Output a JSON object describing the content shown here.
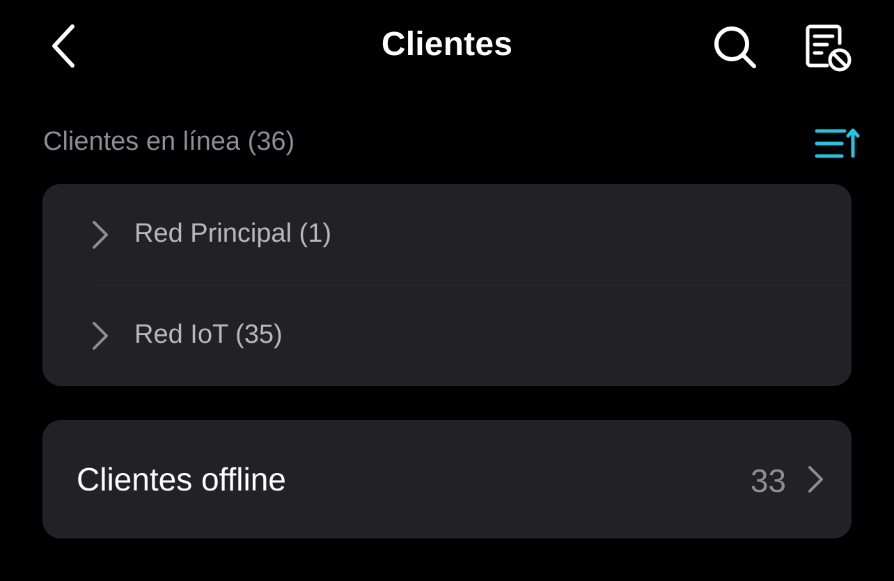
{
  "header": {
    "title": "Clientes",
    "back_icon": "chevron-left-icon",
    "search_icon": "search-icon",
    "blocklist_icon": "document-blocked-icon"
  },
  "online_section": {
    "label": "Clientes en línea (36)",
    "sort_icon": "sort-ascending-icon",
    "groups": [
      {
        "label": "Red Principal (1)",
        "icon": "chevron-right-icon"
      },
      {
        "label": "Red IoT (35)",
        "icon": "chevron-right-icon"
      }
    ]
  },
  "offline_section": {
    "label": "Clientes offline",
    "count": "33",
    "icon": "chevron-right-icon"
  },
  "colors": {
    "background": "#000000",
    "card": "#222226",
    "accent": "#1fc7e6",
    "secondary_text": "#8e8e93",
    "primary_text": "#ffffff"
  }
}
